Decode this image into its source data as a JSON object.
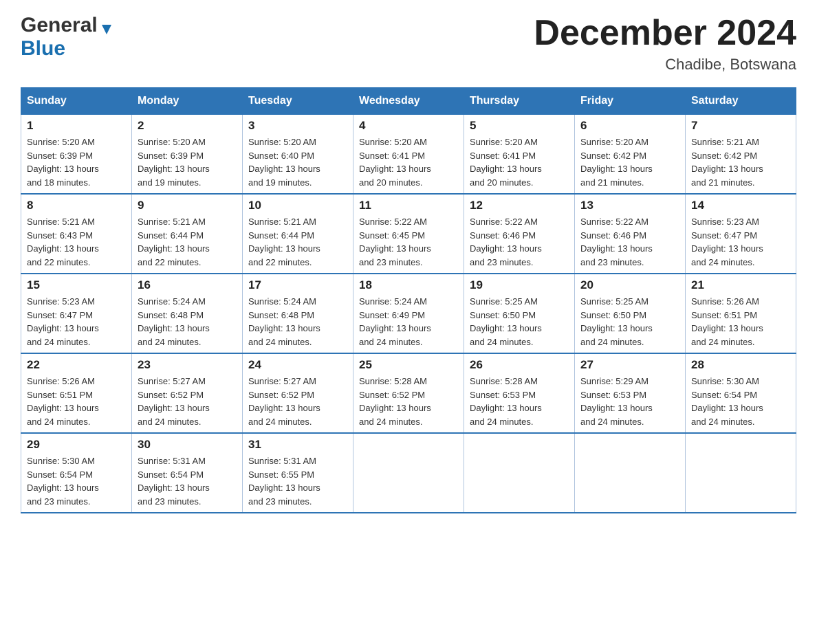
{
  "header": {
    "title": "December 2024",
    "subtitle": "Chadibe, Botswana",
    "logo_general": "General",
    "logo_blue": "Blue"
  },
  "days_of_week": [
    "Sunday",
    "Monday",
    "Tuesday",
    "Wednesday",
    "Thursday",
    "Friday",
    "Saturday"
  ],
  "weeks": [
    [
      {
        "day": "1",
        "sunrise": "5:20 AM",
        "sunset": "6:39 PM",
        "daylight": "13 hours and 18 minutes."
      },
      {
        "day": "2",
        "sunrise": "5:20 AM",
        "sunset": "6:39 PM",
        "daylight": "13 hours and 19 minutes."
      },
      {
        "day": "3",
        "sunrise": "5:20 AM",
        "sunset": "6:40 PM",
        "daylight": "13 hours and 19 minutes."
      },
      {
        "day": "4",
        "sunrise": "5:20 AM",
        "sunset": "6:41 PM",
        "daylight": "13 hours and 20 minutes."
      },
      {
        "day": "5",
        "sunrise": "5:20 AM",
        "sunset": "6:41 PM",
        "daylight": "13 hours and 20 minutes."
      },
      {
        "day": "6",
        "sunrise": "5:20 AM",
        "sunset": "6:42 PM",
        "daylight": "13 hours and 21 minutes."
      },
      {
        "day": "7",
        "sunrise": "5:21 AM",
        "sunset": "6:42 PM",
        "daylight": "13 hours and 21 minutes."
      }
    ],
    [
      {
        "day": "8",
        "sunrise": "5:21 AM",
        "sunset": "6:43 PM",
        "daylight": "13 hours and 22 minutes."
      },
      {
        "day": "9",
        "sunrise": "5:21 AM",
        "sunset": "6:44 PM",
        "daylight": "13 hours and 22 minutes."
      },
      {
        "day": "10",
        "sunrise": "5:21 AM",
        "sunset": "6:44 PM",
        "daylight": "13 hours and 22 minutes."
      },
      {
        "day": "11",
        "sunrise": "5:22 AM",
        "sunset": "6:45 PM",
        "daylight": "13 hours and 23 minutes."
      },
      {
        "day": "12",
        "sunrise": "5:22 AM",
        "sunset": "6:46 PM",
        "daylight": "13 hours and 23 minutes."
      },
      {
        "day": "13",
        "sunrise": "5:22 AM",
        "sunset": "6:46 PM",
        "daylight": "13 hours and 23 minutes."
      },
      {
        "day": "14",
        "sunrise": "5:23 AM",
        "sunset": "6:47 PM",
        "daylight": "13 hours and 24 minutes."
      }
    ],
    [
      {
        "day": "15",
        "sunrise": "5:23 AM",
        "sunset": "6:47 PM",
        "daylight": "13 hours and 24 minutes."
      },
      {
        "day": "16",
        "sunrise": "5:24 AM",
        "sunset": "6:48 PM",
        "daylight": "13 hours and 24 minutes."
      },
      {
        "day": "17",
        "sunrise": "5:24 AM",
        "sunset": "6:48 PM",
        "daylight": "13 hours and 24 minutes."
      },
      {
        "day": "18",
        "sunrise": "5:24 AM",
        "sunset": "6:49 PM",
        "daylight": "13 hours and 24 minutes."
      },
      {
        "day": "19",
        "sunrise": "5:25 AM",
        "sunset": "6:50 PM",
        "daylight": "13 hours and 24 minutes."
      },
      {
        "day": "20",
        "sunrise": "5:25 AM",
        "sunset": "6:50 PM",
        "daylight": "13 hours and 24 minutes."
      },
      {
        "day": "21",
        "sunrise": "5:26 AM",
        "sunset": "6:51 PM",
        "daylight": "13 hours and 24 minutes."
      }
    ],
    [
      {
        "day": "22",
        "sunrise": "5:26 AM",
        "sunset": "6:51 PM",
        "daylight": "13 hours and 24 minutes."
      },
      {
        "day": "23",
        "sunrise": "5:27 AM",
        "sunset": "6:52 PM",
        "daylight": "13 hours and 24 minutes."
      },
      {
        "day": "24",
        "sunrise": "5:27 AM",
        "sunset": "6:52 PM",
        "daylight": "13 hours and 24 minutes."
      },
      {
        "day": "25",
        "sunrise": "5:28 AM",
        "sunset": "6:52 PM",
        "daylight": "13 hours and 24 minutes."
      },
      {
        "day": "26",
        "sunrise": "5:28 AM",
        "sunset": "6:53 PM",
        "daylight": "13 hours and 24 minutes."
      },
      {
        "day": "27",
        "sunrise": "5:29 AM",
        "sunset": "6:53 PM",
        "daylight": "13 hours and 24 minutes."
      },
      {
        "day": "28",
        "sunrise": "5:30 AM",
        "sunset": "6:54 PM",
        "daylight": "13 hours and 24 minutes."
      }
    ],
    [
      {
        "day": "29",
        "sunrise": "5:30 AM",
        "sunset": "6:54 PM",
        "daylight": "13 hours and 23 minutes."
      },
      {
        "day": "30",
        "sunrise": "5:31 AM",
        "sunset": "6:54 PM",
        "daylight": "13 hours and 23 minutes."
      },
      {
        "day": "31",
        "sunrise": "5:31 AM",
        "sunset": "6:55 PM",
        "daylight": "13 hours and 23 minutes."
      },
      null,
      null,
      null,
      null
    ]
  ],
  "labels": {
    "sunrise": "Sunrise:",
    "sunset": "Sunset:",
    "daylight": "Daylight:"
  }
}
